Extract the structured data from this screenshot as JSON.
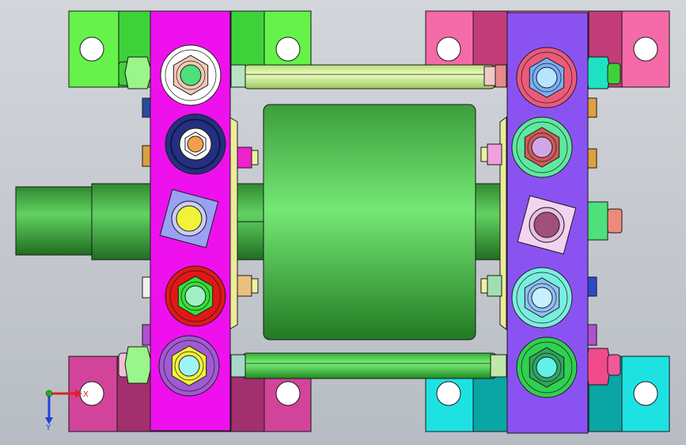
{
  "colors": {
    "background": "#c8ccd2",
    "frame_left": "#ee11ee",
    "frame_right": "#8b52f2",
    "rotor_green": "#5ec85e",
    "shaft_green": "#3f9e3f",
    "rod_light": "#d8f39a",
    "rod_green": "#4bd64b",
    "yellow_plate": "#ecec9a",
    "outline": "#1a1a1a",
    "axis_x": "#e02020",
    "axis_y": "#2040e0",
    "axis_origin": "#20b020"
  },
  "axis_triad": {
    "x_label": "X",
    "y_label": "Y"
  },
  "mounting_blocks": [
    {
      "name": "top-left",
      "color": "#66f24a",
      "accent": "#3ed23a"
    },
    {
      "name": "top-right",
      "color": "#f56aa8",
      "accent": "#c23c7a"
    },
    {
      "name": "bottom-left",
      "color": "#d2449a",
      "accent": "#a2306e"
    },
    {
      "name": "bottom-right",
      "color": "#1ee2e2",
      "accent": "#0aa6a6"
    }
  ],
  "left_fasteners": [
    {
      "type": "hex-nut",
      "ring": "#ffffff",
      "nut": "#f2c8b8",
      "core": "#4ee07a"
    },
    {
      "type": "round-washer",
      "ring": "#24307e",
      "nut": "#ffffff",
      "core": "#f0a04a"
    },
    {
      "type": "square-plate",
      "ring": "#9aa0f4",
      "nut": "#c8ccfa",
      "core": "#f2f23a"
    },
    {
      "type": "hex-nut",
      "ring": "#e01818",
      "nut": "#38e038",
      "core": "#9ef0c2"
    },
    {
      "type": "hex-nut",
      "ring": "#a05ad4",
      "nut": "#f2f23a",
      "core": "#9ef4f4"
    }
  ],
  "right_fasteners": [
    {
      "type": "hex-nut",
      "ring": "#ec5a7a",
      "nut": "#7aaef6",
      "core": "#b8e4ff"
    },
    {
      "type": "hex-nut",
      "ring": "#5ee8a0",
      "nut": "#d05a5a",
      "core": "#d2a6e6"
    },
    {
      "type": "square-plate",
      "ring": "#f2d4f0",
      "nut": "#e8c0e4",
      "core": "#a0507a"
    },
    {
      "type": "hex-nut",
      "ring": "#7aeede",
      "nut": "#8ec0f6",
      "core": "#c8f0ff"
    },
    {
      "type": "hex-nut",
      "ring": "#30d050",
      "nut": "#2ea860",
      "core": "#64f0ea"
    }
  ]
}
